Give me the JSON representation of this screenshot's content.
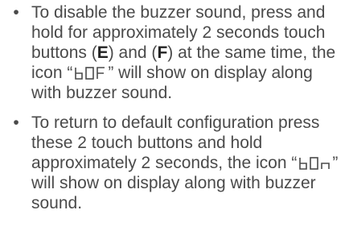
{
  "items": [
    {
      "part1": "To disable the buzzer sound, press and hold for approximately 2 seconds touch buttons (",
      "button_e": "E",
      "part2": ") and (",
      "button_f": "F",
      "part3": ") at the same time, the icon “",
      "icon_name": "b-off-display-icon",
      "icon_text": "bOF",
      "part4": "” will show on display along with buzzer sound."
    },
    {
      "part1": "To return to default configuration press these 2 touch buttons and hold approximately 2 seconds, the icon “",
      "icon_name": "b-on-display-icon",
      "icon_text": "bOn",
      "part2": "” will show on display along with buzzer sound."
    }
  ],
  "bullet": "•"
}
